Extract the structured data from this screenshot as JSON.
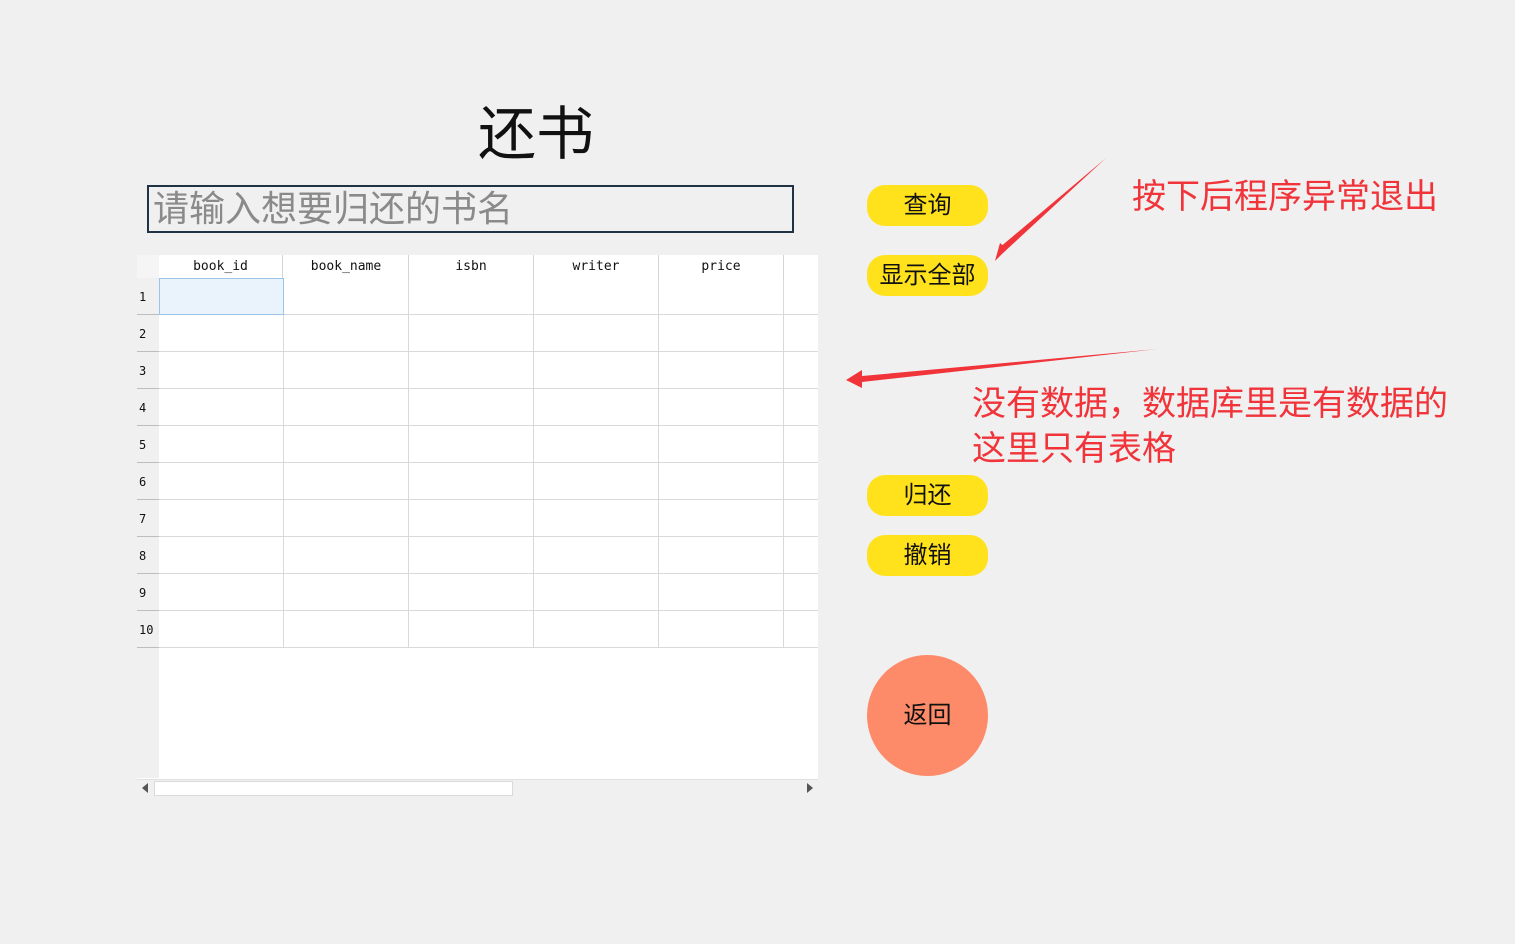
{
  "page": {
    "title": "还书",
    "search": {
      "placeholder": "请输入想要归还的书名",
      "value": ""
    }
  },
  "table": {
    "columns": [
      "book_id",
      "book_name",
      "isbn",
      "writer",
      "price"
    ],
    "row_numbers": [
      "1",
      "2",
      "3",
      "4",
      "5",
      "6",
      "7",
      "8",
      "9",
      "10"
    ],
    "selected_cell": {
      "row": 1,
      "column": "book_id"
    }
  },
  "buttons": {
    "query": "查询",
    "show_all": "显示全部",
    "return_book": "归还",
    "cancel": "撤销",
    "back": "返回"
  },
  "annotations": {
    "crash_note": "按下后程序异常退出",
    "no_data_line1": "没有数据，数据库里是有数据的",
    "no_data_line2": "这里只有表格"
  },
  "colors": {
    "button_yellow": "#ffe21c",
    "back_button": "#fd8a68",
    "annotation_red": "#f0343a",
    "background": "#f0f0f0"
  }
}
